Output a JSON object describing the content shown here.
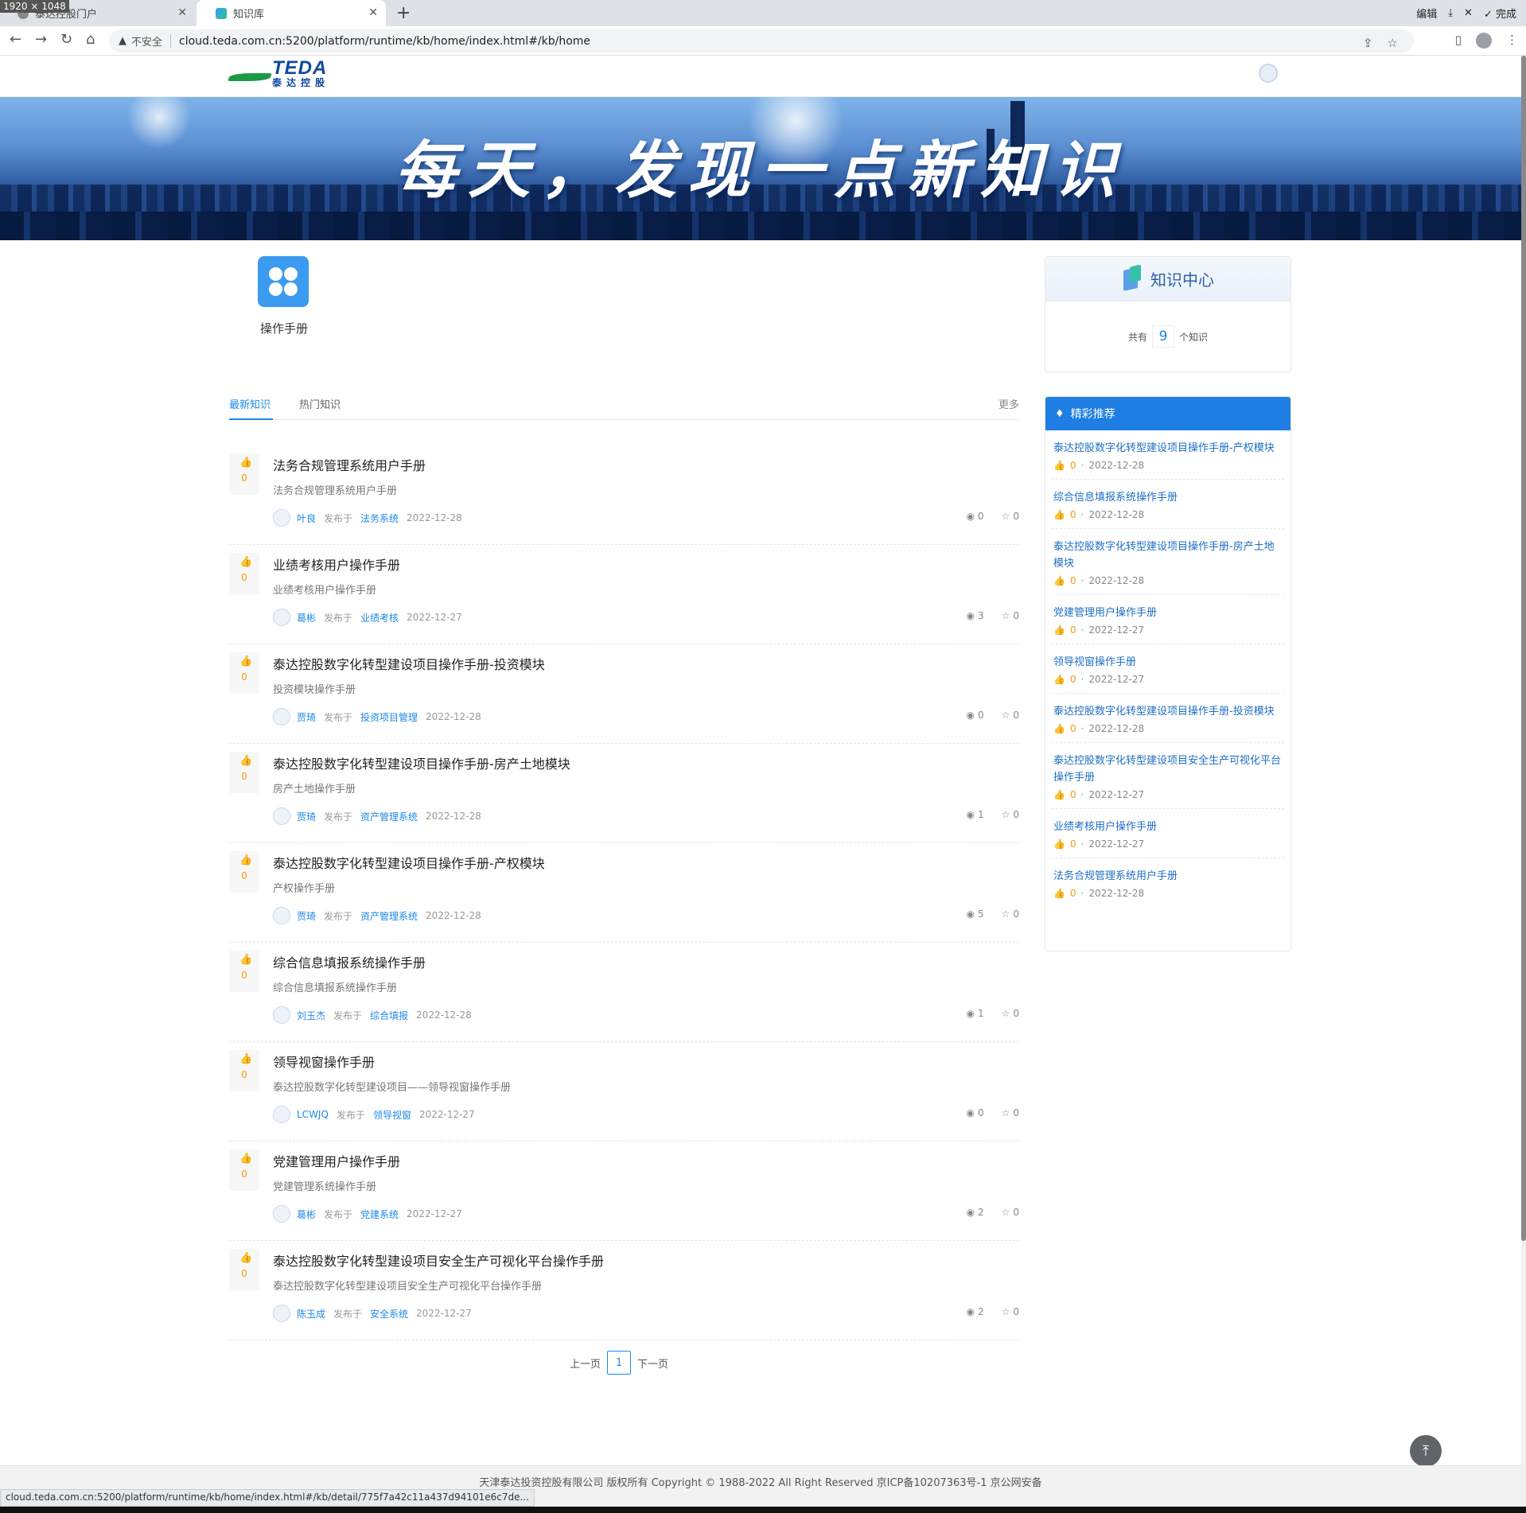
{
  "browser": {
    "dimension_badge": "1920 × 1048",
    "tabs": [
      {
        "title": "泰达控股门户"
      },
      {
        "title": "知识库"
      }
    ],
    "download_bar": {
      "edit": "编辑",
      "done": "完成"
    },
    "insecure_label": "不安全",
    "url": "cloud.teda.com.cn:5200/platform/runtime/kb/home/index.html#/kb/home",
    "status_url": "cloud.teda.com.cn:5200/platform/runtime/kb/home/index.html#/kb/detail/775f7a42c11a437d94101e6c7de..."
  },
  "header": {
    "logo_en": "TEDA",
    "logo_cn": "泰达控股"
  },
  "banner": {
    "title": "每天，发现一点新知识"
  },
  "category": {
    "label": "操作手册"
  },
  "tabs": {
    "latest": "最新知识",
    "hot": "热门知识",
    "more": "更多"
  },
  "labels": {
    "published_in": "发布于"
  },
  "items": [
    {
      "title": "法务合规管理系统用户手册",
      "desc": "法务合规管理系统用户手册",
      "author": "叶良",
      "category": "法务系统",
      "date": "2022-12-28",
      "likes": "0",
      "views": "0",
      "stars": "0"
    },
    {
      "title": "业绩考核用户操作手册",
      "desc": "业绩考核用户操作手册",
      "author": "葛彬",
      "category": "业绩考核",
      "date": "2022-12-27",
      "likes": "0",
      "views": "3",
      "stars": "0"
    },
    {
      "title": "泰达控股数字化转型建设项目操作手册-投资模块",
      "desc": "投资模块操作手册",
      "author": "贾琦",
      "category": "投资项目管理",
      "date": "2022-12-28",
      "likes": "0",
      "views": "0",
      "stars": "0"
    },
    {
      "title": "泰达控股数字化转型建设项目操作手册-房产土地模块",
      "desc": "房产土地操作手册",
      "author": "贾琦",
      "category": "资产管理系统",
      "date": "2022-12-28",
      "likes": "0",
      "views": "1",
      "stars": "0"
    },
    {
      "title": "泰达控股数字化转型建设项目操作手册-产权模块",
      "desc": "产权操作手册",
      "author": "贾琦",
      "category": "资产管理系统",
      "date": "2022-12-28",
      "likes": "0",
      "views": "5",
      "stars": "0"
    },
    {
      "title": "综合信息填报系统操作手册",
      "desc": "综合信息填报系统操作手册",
      "author": "刘玉杰",
      "category": "综合填报",
      "date": "2022-12-28",
      "likes": "0",
      "views": "1",
      "stars": "0"
    },
    {
      "title": "领导视窗操作手册",
      "desc": "泰达控股数字化转型建设项目——领导视窗操作手册",
      "author": "LCWJQ",
      "category": "领导视窗",
      "date": "2022-12-27",
      "likes": "0",
      "views": "0",
      "stars": "0"
    },
    {
      "title": "党建管理用户操作手册",
      "desc": "党建管理系统操作手册",
      "author": "葛彬",
      "category": "党建系统",
      "date": "2022-12-27",
      "likes": "0",
      "views": "2",
      "stars": "0"
    },
    {
      "title": "泰达控股数字化转型建设项目安全生产可视化平台操作手册",
      "desc": "泰达控股数字化转型建设项目安全生产可视化平台操作手册",
      "author": "陈玉成",
      "category": "安全系统",
      "date": "2022-12-27",
      "likes": "0",
      "views": "2",
      "stars": "0"
    }
  ],
  "pager": {
    "prev": "上一页",
    "current": "1",
    "next": "下一页"
  },
  "knowledge_center": {
    "title": "知识中心",
    "prefix": "共有",
    "count": "9",
    "suffix": "个知识"
  },
  "recommend": {
    "title": "精彩推荐",
    "items": [
      {
        "title": "泰达控股数字化转型建设项目操作手册-产权模块",
        "likes": "0",
        "date": "2022-12-28"
      },
      {
        "title": "综合信息填报系统操作手册",
        "likes": "0",
        "date": "2022-12-28"
      },
      {
        "title": "泰达控股数字化转型建设项目操作手册-房产土地模块",
        "likes": "0",
        "date": "2022-12-28"
      },
      {
        "title": "党建管理用户操作手册",
        "likes": "0",
        "date": "2022-12-27"
      },
      {
        "title": "领导视窗操作手册",
        "likes": "0",
        "date": "2022-12-27"
      },
      {
        "title": "泰达控股数字化转型建设项目操作手册-投资模块",
        "likes": "0",
        "date": "2022-12-28"
      },
      {
        "title": "泰达控股数字化转型建设项目安全生产可视化平台操作手册",
        "likes": "0",
        "date": "2022-12-27"
      },
      {
        "title": "业绩考核用户操作手册",
        "likes": "0",
        "date": "2022-12-27"
      },
      {
        "title": "法务合规管理系统用户手册",
        "likes": "0",
        "date": "2022-12-28"
      }
    ]
  },
  "footer": {
    "text": "天津泰达投资控股有限公司 版权所有 Copyright © 1988-2022 All Right Reserved 京ICP备10207363号-1 京公网安备"
  },
  "colors": {
    "accent": "#1e88e5",
    "like": "#f39c12",
    "recommend_header": "#1e7ee4"
  }
}
